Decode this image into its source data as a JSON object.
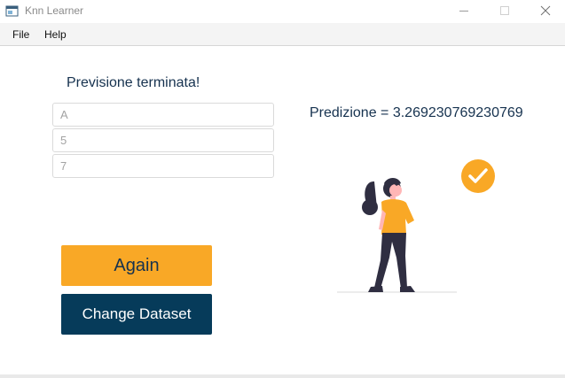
{
  "window": {
    "title": "Knn Learner",
    "icons": {
      "app": "app-window-icon",
      "minimize": "minimize-icon",
      "maximize": "maximize-icon",
      "close": "close-icon"
    }
  },
  "menu": {
    "items": [
      {
        "label": "File"
      },
      {
        "label": "Help"
      }
    ]
  },
  "main": {
    "status_text": "Previsione terminata!",
    "fields": [
      {
        "value": "A"
      },
      {
        "value": "5"
      },
      {
        "value": "7"
      }
    ],
    "prediction": "Predizione = 3.269230769230769",
    "buttons": {
      "again": "Again",
      "change_dataset": "Change Dataset"
    },
    "illustration": {
      "icons": [
        "woman-figure-illustration",
        "checkmark-circle-icon"
      ]
    }
  },
  "colors": {
    "accent": "#f9a826",
    "primary_dark": "#063b5a",
    "text_dark": "#16324f",
    "placeholder_text": "#a3a3a3"
  }
}
